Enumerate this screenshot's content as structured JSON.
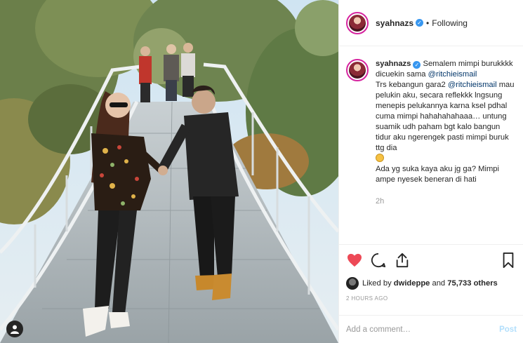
{
  "post": {
    "username": "syahnazs",
    "separator": "•",
    "follow_status": "Following",
    "caption_parts": {
      "line1": "Semalem mimpi burukkkk dicuekin sama",
      "mention1": "@ritchieismail",
      "line2a": "Trs kebangun gara2",
      "mention2": "@ritchieismail",
      "line2b": "mau pelukin aku, secara reflekkk lngsung menepis pelukannya karna ksel pdhal cuma mimpi hahahahahaaa… untung suamik udh paham bgt kalo bangun tidur aku ngerengek pasti mimpi buruk ttg dia",
      "line3": "Ada yg suka kaya aku jg ga? Mimpi ampe nyesek beneran di hati"
    },
    "caption_time": "2h",
    "likes": {
      "prefix": "Liked by",
      "user": "dwideppe",
      "middle": "and",
      "count": "75,733 others"
    },
    "posted_ago": "2 HOURS AGO",
    "comment_placeholder": "Add a comment…",
    "post_button": "Post"
  },
  "icons": {
    "verified": "verified-badge-icon",
    "like": "heart-icon",
    "comment": "comment-icon",
    "share": "share-icon",
    "save": "bookmark-icon",
    "tag": "user-tag-icon"
  },
  "colors": {
    "like_red": "#ed4956",
    "verified_blue": "#3897f0",
    "mention": "#003569",
    "muted": "#999999",
    "story_ring": "#d6249f"
  }
}
